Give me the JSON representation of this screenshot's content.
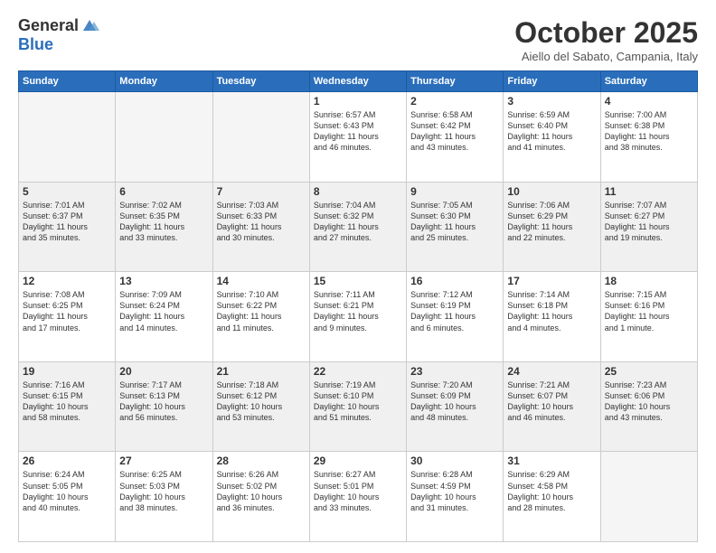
{
  "header": {
    "logo_general": "General",
    "logo_blue": "Blue",
    "month": "October 2025",
    "location": "Aiello del Sabato, Campania, Italy"
  },
  "weekdays": [
    "Sunday",
    "Monday",
    "Tuesday",
    "Wednesday",
    "Thursday",
    "Friday",
    "Saturday"
  ],
  "weeks": [
    [
      {
        "day": "",
        "info": "",
        "empty": true
      },
      {
        "day": "",
        "info": "",
        "empty": true
      },
      {
        "day": "",
        "info": "",
        "empty": true
      },
      {
        "day": "1",
        "info": "Sunrise: 6:57 AM\nSunset: 6:43 PM\nDaylight: 11 hours\nand 46 minutes."
      },
      {
        "day": "2",
        "info": "Sunrise: 6:58 AM\nSunset: 6:42 PM\nDaylight: 11 hours\nand 43 minutes."
      },
      {
        "day": "3",
        "info": "Sunrise: 6:59 AM\nSunset: 6:40 PM\nDaylight: 11 hours\nand 41 minutes."
      },
      {
        "day": "4",
        "info": "Sunrise: 7:00 AM\nSunset: 6:38 PM\nDaylight: 11 hours\nand 38 minutes."
      }
    ],
    [
      {
        "day": "5",
        "info": "Sunrise: 7:01 AM\nSunset: 6:37 PM\nDaylight: 11 hours\nand 35 minutes."
      },
      {
        "day": "6",
        "info": "Sunrise: 7:02 AM\nSunset: 6:35 PM\nDaylight: 11 hours\nand 33 minutes."
      },
      {
        "day": "7",
        "info": "Sunrise: 7:03 AM\nSunset: 6:33 PM\nDaylight: 11 hours\nand 30 minutes."
      },
      {
        "day": "8",
        "info": "Sunrise: 7:04 AM\nSunset: 6:32 PM\nDaylight: 11 hours\nand 27 minutes."
      },
      {
        "day": "9",
        "info": "Sunrise: 7:05 AM\nSunset: 6:30 PM\nDaylight: 11 hours\nand 25 minutes."
      },
      {
        "day": "10",
        "info": "Sunrise: 7:06 AM\nSunset: 6:29 PM\nDaylight: 11 hours\nand 22 minutes."
      },
      {
        "day": "11",
        "info": "Sunrise: 7:07 AM\nSunset: 6:27 PM\nDaylight: 11 hours\nand 19 minutes."
      }
    ],
    [
      {
        "day": "12",
        "info": "Sunrise: 7:08 AM\nSunset: 6:25 PM\nDaylight: 11 hours\nand 17 minutes."
      },
      {
        "day": "13",
        "info": "Sunrise: 7:09 AM\nSunset: 6:24 PM\nDaylight: 11 hours\nand 14 minutes."
      },
      {
        "day": "14",
        "info": "Sunrise: 7:10 AM\nSunset: 6:22 PM\nDaylight: 11 hours\nand 11 minutes."
      },
      {
        "day": "15",
        "info": "Sunrise: 7:11 AM\nSunset: 6:21 PM\nDaylight: 11 hours\nand 9 minutes."
      },
      {
        "day": "16",
        "info": "Sunrise: 7:12 AM\nSunset: 6:19 PM\nDaylight: 11 hours\nand 6 minutes."
      },
      {
        "day": "17",
        "info": "Sunrise: 7:14 AM\nSunset: 6:18 PM\nDaylight: 11 hours\nand 4 minutes."
      },
      {
        "day": "18",
        "info": "Sunrise: 7:15 AM\nSunset: 6:16 PM\nDaylight: 11 hours\nand 1 minute."
      }
    ],
    [
      {
        "day": "19",
        "info": "Sunrise: 7:16 AM\nSunset: 6:15 PM\nDaylight: 10 hours\nand 58 minutes."
      },
      {
        "day": "20",
        "info": "Sunrise: 7:17 AM\nSunset: 6:13 PM\nDaylight: 10 hours\nand 56 minutes."
      },
      {
        "day": "21",
        "info": "Sunrise: 7:18 AM\nSunset: 6:12 PM\nDaylight: 10 hours\nand 53 minutes."
      },
      {
        "day": "22",
        "info": "Sunrise: 7:19 AM\nSunset: 6:10 PM\nDaylight: 10 hours\nand 51 minutes."
      },
      {
        "day": "23",
        "info": "Sunrise: 7:20 AM\nSunset: 6:09 PM\nDaylight: 10 hours\nand 48 minutes."
      },
      {
        "day": "24",
        "info": "Sunrise: 7:21 AM\nSunset: 6:07 PM\nDaylight: 10 hours\nand 46 minutes."
      },
      {
        "day": "25",
        "info": "Sunrise: 7:23 AM\nSunset: 6:06 PM\nDaylight: 10 hours\nand 43 minutes."
      }
    ],
    [
      {
        "day": "26",
        "info": "Sunrise: 6:24 AM\nSunset: 5:05 PM\nDaylight: 10 hours\nand 40 minutes."
      },
      {
        "day": "27",
        "info": "Sunrise: 6:25 AM\nSunset: 5:03 PM\nDaylight: 10 hours\nand 38 minutes."
      },
      {
        "day": "28",
        "info": "Sunrise: 6:26 AM\nSunset: 5:02 PM\nDaylight: 10 hours\nand 36 minutes."
      },
      {
        "day": "29",
        "info": "Sunrise: 6:27 AM\nSunset: 5:01 PM\nDaylight: 10 hours\nand 33 minutes."
      },
      {
        "day": "30",
        "info": "Sunrise: 6:28 AM\nSunset: 4:59 PM\nDaylight: 10 hours\nand 31 minutes."
      },
      {
        "day": "31",
        "info": "Sunrise: 6:29 AM\nSunset: 4:58 PM\nDaylight: 10 hours\nand 28 minutes."
      },
      {
        "day": "",
        "info": "",
        "empty": true
      }
    ]
  ]
}
